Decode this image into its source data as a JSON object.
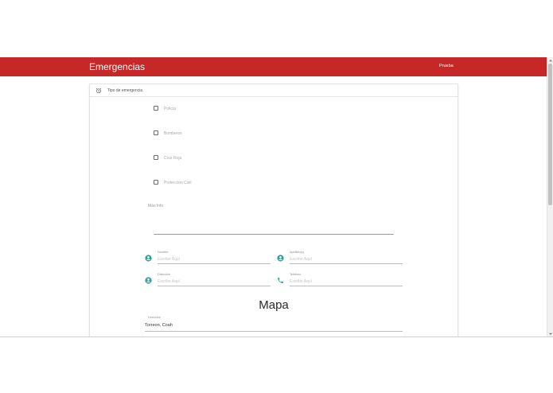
{
  "appbar": {
    "title": "Emergencias",
    "user": "Prueba",
    "color": "#c62828"
  },
  "card": {
    "header": {
      "icon": "alarm-clock-icon",
      "label": "Tipo de emergencia"
    },
    "checkboxes": [
      {
        "label": "Policía",
        "checked": false
      },
      {
        "label": "Bomberos",
        "checked": false
      },
      {
        "label": "Cruz Roja",
        "checked": false
      },
      {
        "label": "Proteccion Civil",
        "checked": false
      }
    ],
    "mas_info": {
      "label": "Más Info",
      "value": ""
    },
    "fields": [
      {
        "label": "Nombre",
        "placeholder": "Escribe Aquí",
        "icon": "account-circle-icon"
      },
      {
        "label": "Apellido(s)",
        "placeholder": "Escribe Aquí",
        "icon": "account-circle-icon"
      },
      {
        "label": "Dirección",
        "placeholder": "Escribe Aquí",
        "icon": "account-circle-icon"
      },
      {
        "label": "Telefono",
        "placeholder": "Escribe Aquí",
        "icon": "phone-icon"
      }
    ],
    "mapa": {
      "title": "Mapa",
      "direccion_label": "Dirección",
      "direccion_value": "Torreon, Coah"
    }
  },
  "colors": {
    "accent": "#26a69a",
    "appbar": "#c62828"
  }
}
